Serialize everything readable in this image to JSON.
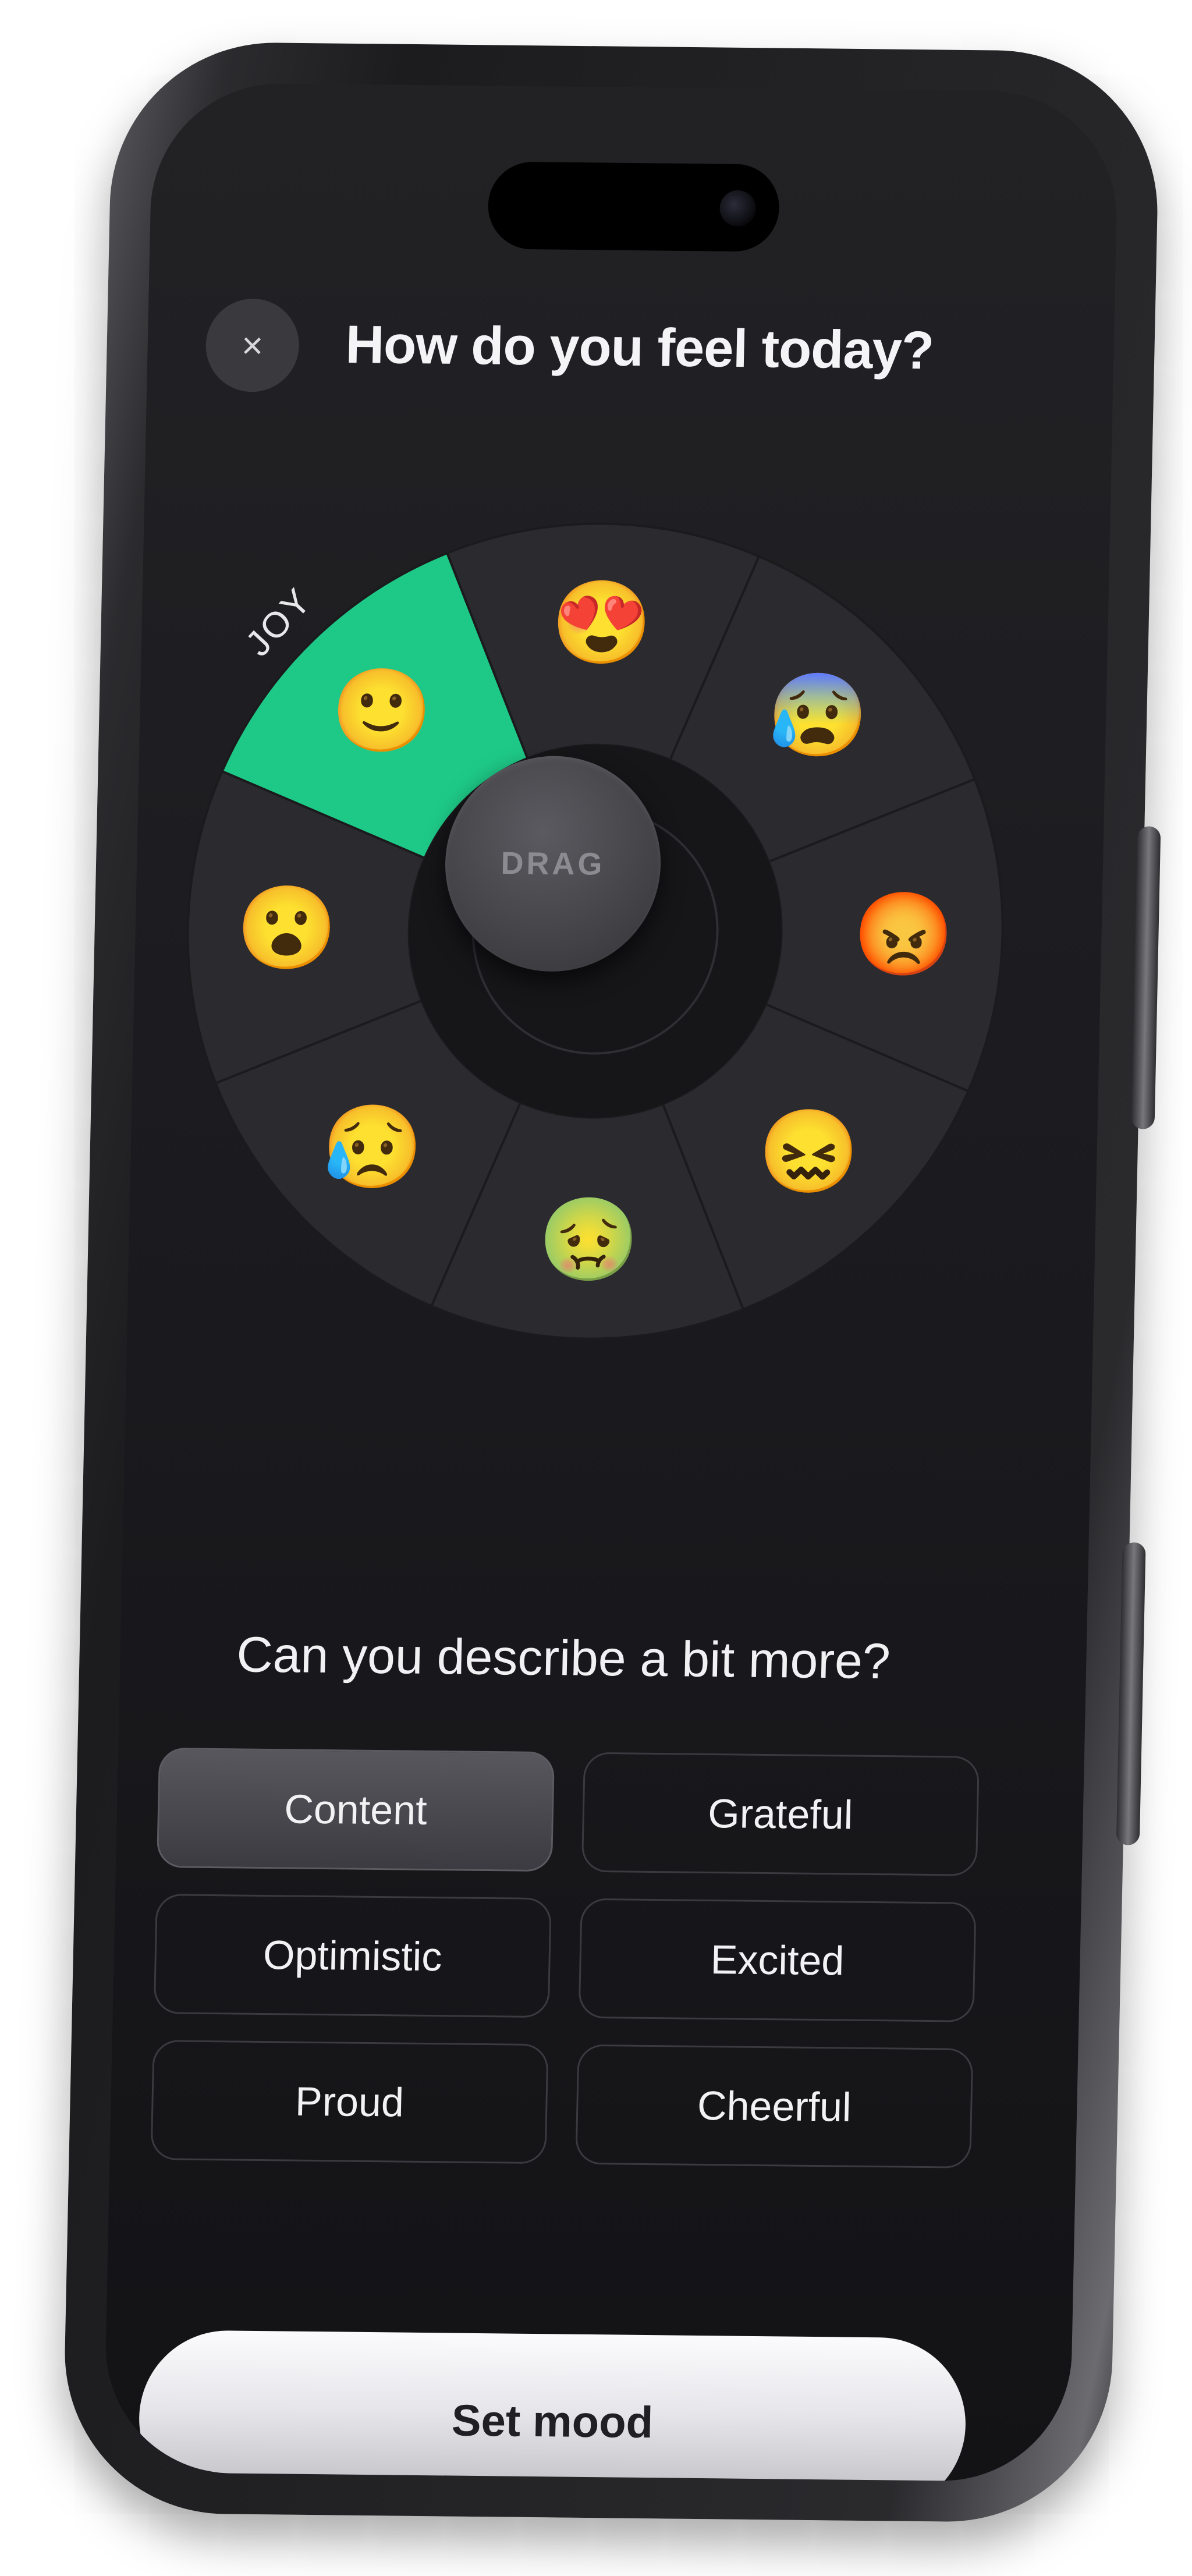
{
  "header": {
    "close_icon": "×",
    "title": "How do you feel today?"
  },
  "wheel": {
    "selected_label": "JOY",
    "knob_label": "DRAG",
    "accent_color": "#1ec987",
    "segments": [
      {
        "emoji": "🙂",
        "icon": "grinning-face-icon",
        "selected": true
      },
      {
        "emoji": "😍",
        "icon": "heart-eyes-face-icon",
        "selected": false
      },
      {
        "emoji": "😰",
        "icon": "anxious-face-icon",
        "selected": false
      },
      {
        "emoji": "😡",
        "icon": "angry-face-icon",
        "selected": false
      },
      {
        "emoji": "😖",
        "icon": "confounded-face-icon",
        "selected": false
      },
      {
        "emoji": "🤢",
        "icon": "nauseated-face-icon",
        "selected": false
      },
      {
        "emoji": "😥",
        "icon": "sad-relieved-face-icon",
        "selected": false
      },
      {
        "emoji": "😮",
        "icon": "surprised-face-icon",
        "selected": false
      }
    ]
  },
  "section": {
    "subtitle": "Can you describe a bit more?",
    "options": [
      {
        "label": "Content",
        "selected": true
      },
      {
        "label": "Grateful",
        "selected": false
      },
      {
        "label": "Optimistic",
        "selected": false
      },
      {
        "label": "Excited",
        "selected": false
      },
      {
        "label": "Proud",
        "selected": false
      },
      {
        "label": "Cheerful",
        "selected": false
      }
    ]
  },
  "cta": {
    "label": "Set mood"
  }
}
